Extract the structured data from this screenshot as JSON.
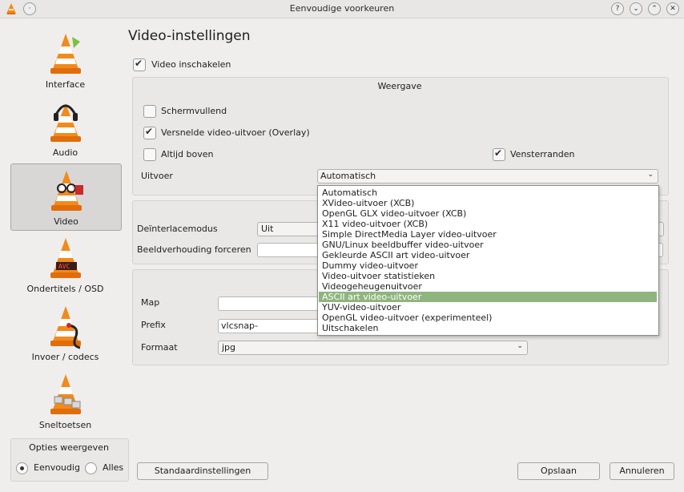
{
  "window": {
    "title": "Eenvoudige voorkeuren",
    "buttons": [
      "?",
      "⌄",
      "⌃",
      "✕"
    ]
  },
  "sidebar": {
    "items": [
      {
        "label": "Interface"
      },
      {
        "label": "Audio"
      },
      {
        "label": "Video"
      },
      {
        "label": "Ondertitels / OSD"
      },
      {
        "label": "Invoer / codecs"
      },
      {
        "label": "Sneltoetsen"
      }
    ],
    "options_title": "Opties weergeven",
    "option_simple": "Eenvoudig",
    "option_all": "Alles"
  },
  "page": {
    "title": "Video-instellingen",
    "enable_video": "Video inschakelen",
    "display": {
      "title": "Weergave",
      "fullscreen": "Schermvullend",
      "overlay": "Versnelde video-uitvoer (Overlay)",
      "always_on_top": "Altijd boven",
      "window_decorations": "Vensterranden",
      "output_label": "Uitvoer",
      "output_value": "Automatisch"
    },
    "video": {
      "deinterlace_label": "Deïnterlacemodus",
      "deinterlace_value": "Uit",
      "aspect_label": "Beeldverhouding forceren",
      "aspect_value": ""
    },
    "snapshot": {
      "map_label": "Map",
      "map_value": "",
      "prefix_label": "Prefix",
      "prefix_value": "vlcsnap-",
      "format_label": "Formaat",
      "format_value": "jpg"
    },
    "dropdown": [
      "Automatisch",
      "XVideo-uitvoer (XCB)",
      "OpenGL GLX video-uitvoer (XCB)",
      "X11 video-uitvoer (XCB)",
      "Simple DirectMedia Layer video-uitvoer",
      "GNU/Linux beeldbuffer video-uitvoer",
      "Gekleurde ASCII art video-uitvoer",
      "Dummy video-uitvoer",
      "Video-uitvoer statistieken",
      "Videogeheugenuitvoer",
      "ASCII art video-uitvoer",
      "YUV-video-uitvoer",
      "OpenGL video-uitvoer (experimenteel)",
      "Uitschakelen"
    ],
    "dropdown_highlight_index": 10
  },
  "footer": {
    "reset": "Standaardinstellingen",
    "save": "Opslaan",
    "cancel": "Annuleren"
  },
  "colors": {
    "highlight": "#8fb57f",
    "cone_orange": "#f28a1c"
  }
}
